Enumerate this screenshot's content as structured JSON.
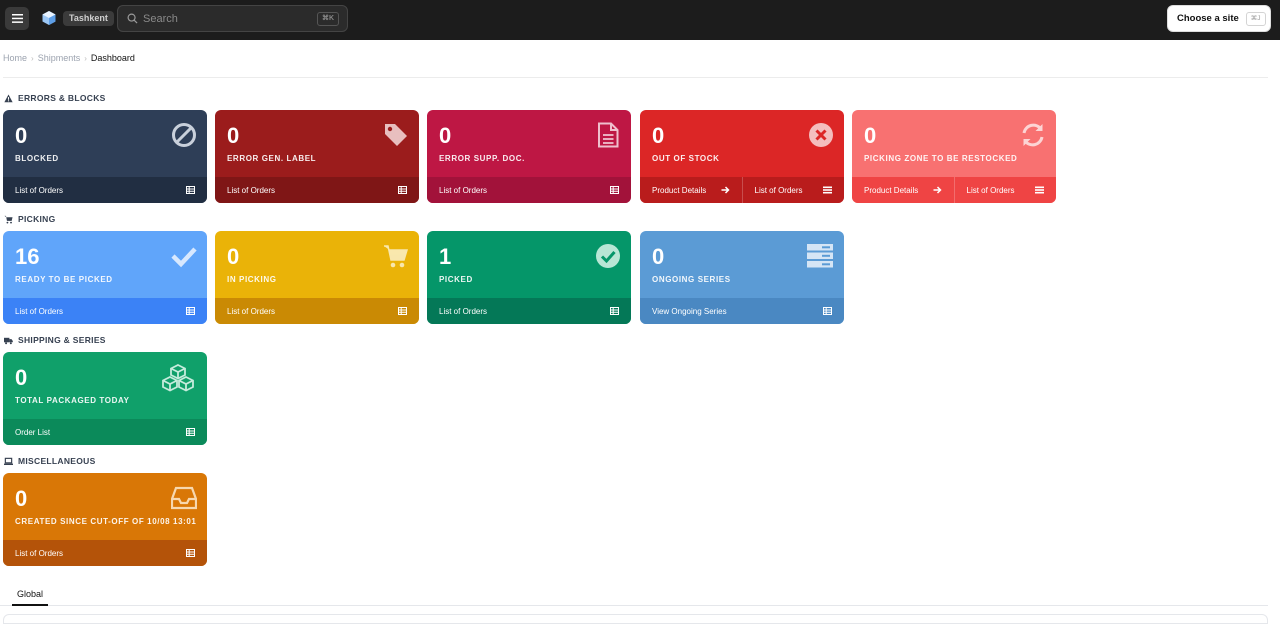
{
  "topbar": {
    "site_badge": "Tashkent",
    "search_placeholder": "Search",
    "search_shortcut": "⌘K",
    "choose_site_label": "Choose a site",
    "choose_site_shortcut": "⌘J"
  },
  "breadcrumb": {
    "home": "Home",
    "shipments": "Shipments",
    "current": "Dashboard"
  },
  "sections": {
    "errors": "ERRORS & BLOCKS",
    "picking": "PICKING",
    "shipping": "SHIPPING & SERIES",
    "misc": "MISCELLANEOUS"
  },
  "cards": {
    "blocked": {
      "value": "0",
      "label": "BLOCKED",
      "foot": "List of Orders",
      "icon": "ban-icon",
      "color": "#2e3e57"
    },
    "error_label": {
      "value": "0",
      "label": "ERROR GEN. LABEL",
      "foot": "List of Orders",
      "icon": "tag-icon",
      "color": "#9b1c1c"
    },
    "error_doc": {
      "value": "0",
      "label": "ERROR SUPP. DOC.",
      "foot": "List of Orders",
      "icon": "document-icon",
      "color": "#be1744"
    },
    "out_of_stock": {
      "value": "0",
      "label": "OUT OF STOCK",
      "foot_left": "Product Details",
      "foot_right": "List of Orders",
      "icon": "times-circle-icon",
      "color": "#dc2626"
    },
    "restock": {
      "value": "0",
      "label": "PICKING ZONE TO BE RESTOCKED",
      "foot_left": "Product Details",
      "foot_right": "List of Orders",
      "icon": "refresh-icon",
      "color": "#f87171"
    },
    "ready": {
      "value": "16",
      "label": "READY TO BE PICKED",
      "foot": "List of Orders",
      "icon": "check-icon",
      "color": "#60a5fa"
    },
    "in_picking": {
      "value": "0",
      "label": "IN PICKING",
      "foot": "List of Orders",
      "icon": "cart-icon",
      "color": "#eab308"
    },
    "picked": {
      "value": "1",
      "label": "PICKED",
      "foot": "List of Orders",
      "icon": "check-circle-icon",
      "color": "#059669"
    },
    "ongoing": {
      "value": "0",
      "label": "ONGOING SERIES",
      "foot": "View Ongoing Series",
      "icon": "server-icon",
      "color": "#5b9bd5"
    },
    "packaged": {
      "value": "0",
      "label": "TOTAL PACKAGED TODAY",
      "foot": "Order List",
      "icon": "cubes-icon",
      "color": "#10a06a"
    },
    "created": {
      "value": "0",
      "label": "CREATED SINCE CUT-OFF OF 10/08 13:01",
      "foot": "List of Orders",
      "icon": "inbox-icon",
      "color": "#d97706"
    }
  },
  "tabs": {
    "global": "Global"
  }
}
